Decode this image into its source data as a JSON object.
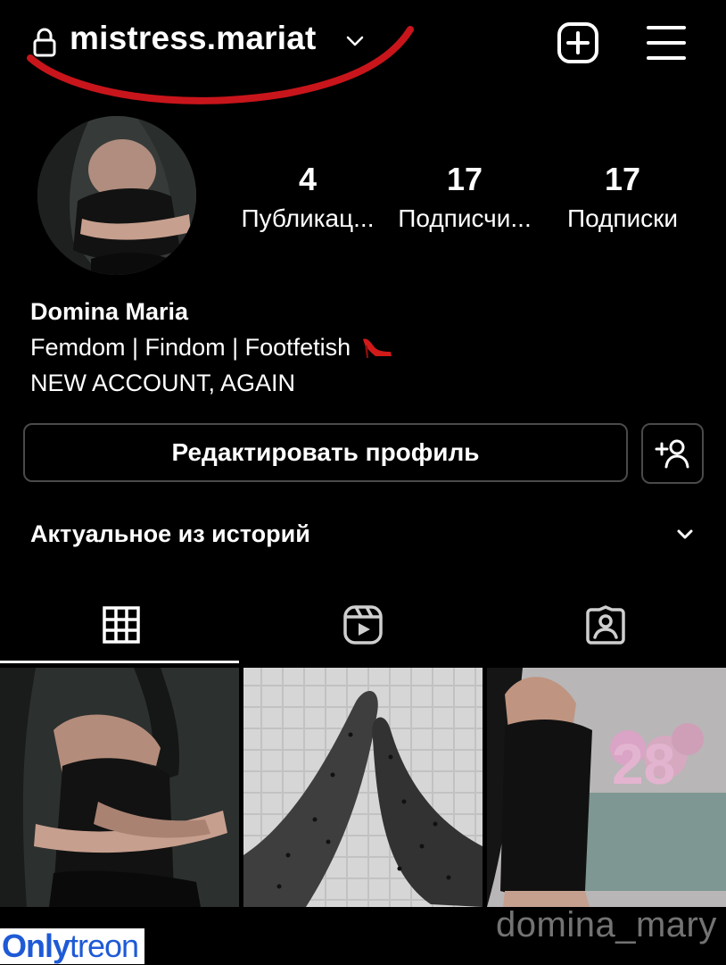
{
  "header": {
    "username": "mistress.mariat",
    "icons": {
      "lock": "lock-icon",
      "chevron": "chevron-down-icon",
      "create": "plus-square-icon",
      "menu": "hamburger-menu-icon"
    },
    "scribble_color": "#c8151b"
  },
  "stats": [
    {
      "value": "4",
      "label": "Публикац..."
    },
    {
      "value": "17",
      "label": "Подписчи..."
    },
    {
      "value": "17",
      "label": "Подписки"
    }
  ],
  "bio": {
    "name": "Domina Maria",
    "line1": "Femdom | Findom | Footfetish",
    "line1_emoji": "high-heel-icon",
    "line2": "NEW ACCOUNT, AGAIN"
  },
  "actions": {
    "edit_profile": "Редактировать профиль",
    "add_user_icon": "add-user-icon"
  },
  "highlights": {
    "title": "Актуальное из историй",
    "icon": "chevron-down-icon"
  },
  "tabs": [
    {
      "icon": "grid-icon",
      "active": true
    },
    {
      "icon": "reels-icon",
      "active": false
    },
    {
      "icon": "tagged-icon",
      "active": false
    }
  ],
  "posts": [
    {
      "desc": "woman in black leather corset"
    },
    {
      "desc": "feet in polka-dot stockings"
    },
    {
      "desc": "woman in black leather dress with 28 balloons"
    }
  ],
  "watermarks": {
    "handle": "domina_mary",
    "site_a": "Only",
    "site_b": "treon"
  },
  "colors": {
    "background": "#000000",
    "text": "#ffffff",
    "border": "#4a4a4a",
    "watermark_blue": "#1e5ad6"
  }
}
